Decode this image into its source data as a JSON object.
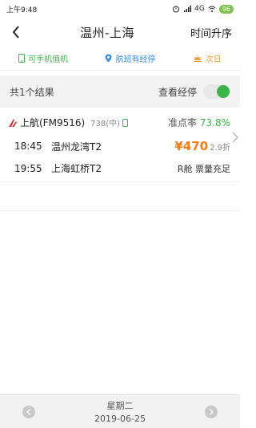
{
  "status": {
    "time": "上午9:48",
    "network": "4G",
    "battery": "96"
  },
  "nav": {
    "title": "温州-上海",
    "sort_label": "时间升序"
  },
  "filters": [
    {
      "label": "可手机值机"
    },
    {
      "label": "航班有经停"
    },
    {
      "label": "次日"
    }
  ],
  "results": {
    "count_label": "共1个结果",
    "stops_toggle_label": "查看经停",
    "stops_toggle_on": true
  },
  "flight": {
    "airline": "上航(FM9516)",
    "aircraft": "738(中)",
    "ontime_label": "准点率",
    "ontime_value": "73.8%",
    "depart_time": "18:45",
    "depart_airport": "温州龙湾T2",
    "arrive_time": "19:55",
    "arrive_airport": "上海虹桥T2",
    "price": "¥470",
    "discount": "2.9折",
    "cabin": "R舱 票量充足"
  },
  "bottom": {
    "weekday": "星期二",
    "date": "2019-06-25"
  },
  "colors": {
    "accent_green": "#3bb54a",
    "accent_blue": "#3a8ee6",
    "accent_orange": "#f57c19",
    "airline_red": "#d9302b"
  }
}
